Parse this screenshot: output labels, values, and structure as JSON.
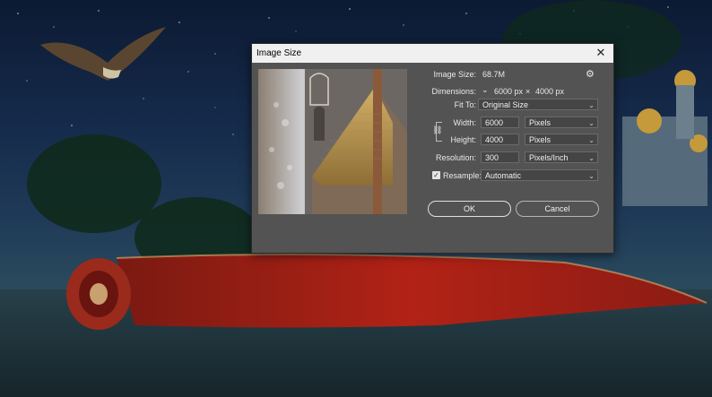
{
  "dialog": {
    "title": "Image Size",
    "close_glyph": "✕",
    "image_size_label": "Image Size:",
    "image_size_value": "68.7M",
    "dimensions_label": "Dimensions:",
    "dimensions_width": "6000 px",
    "dimensions_x": "×",
    "dimensions_height": "4000 px",
    "fit_to_label": "Fit To:",
    "fit_to_value": "Original Size",
    "width_label": "Width:",
    "width_value": "6000",
    "width_unit": "Pixels",
    "height_label": "Height:",
    "height_value": "4000",
    "height_unit": "Pixels",
    "resolution_label": "Resolution:",
    "resolution_value": "300",
    "resolution_unit": "Pixels/Inch",
    "resample_label": "Resample:",
    "resample_checked": true,
    "resample_value": "Automatic",
    "ok_label": "OK",
    "cancel_label": "Cancel"
  },
  "icons": {
    "close": "close-icon",
    "gear": "gear-icon",
    "chevron": "chevron-down-icon",
    "link": "link-icon",
    "checkbox": "checkbox-icon"
  },
  "colors": {
    "dialog_bg": "#535353",
    "titlebar_bg": "#f0f0f0",
    "field_bg": "#454545",
    "text": "#e8e8e8"
  }
}
